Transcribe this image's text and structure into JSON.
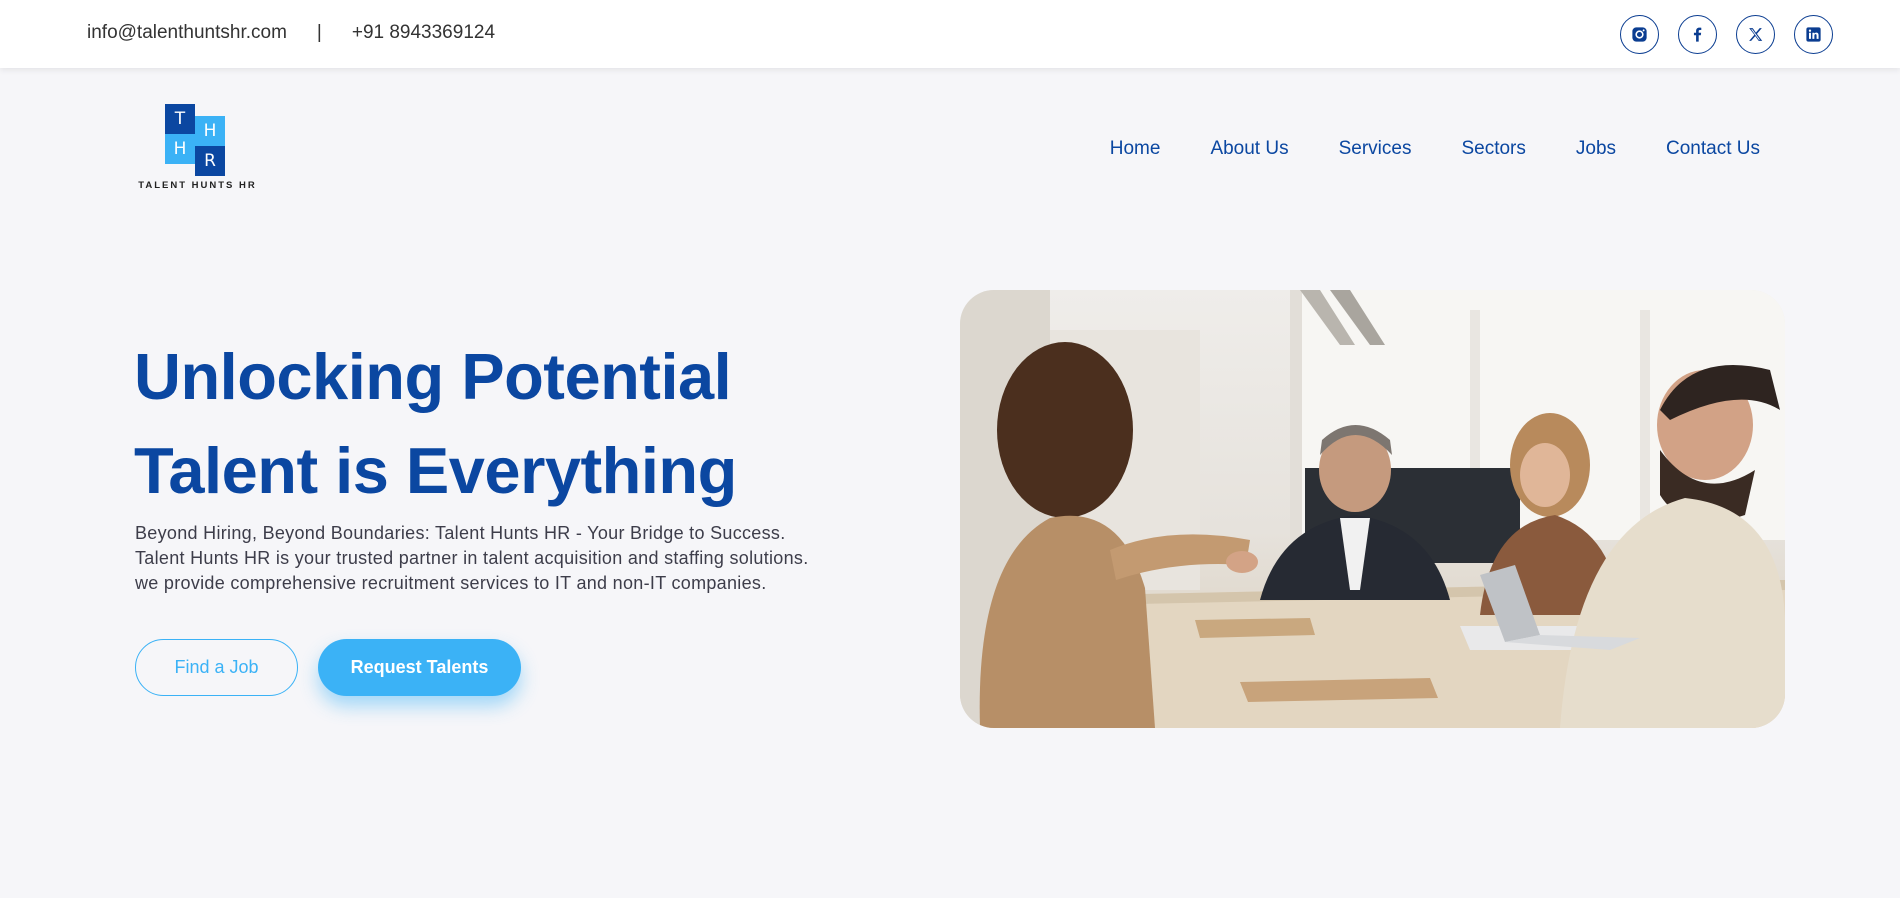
{
  "topbar": {
    "email": "info@talenthuntshr.com",
    "separator": "|",
    "phone": "+91 8943369124",
    "socials": [
      "instagram-icon",
      "facebook-icon",
      "x-icon",
      "linkedin-icon"
    ]
  },
  "logo": {
    "letters": [
      "T",
      "H",
      "H",
      "R"
    ],
    "text": "TALENT HUNTS HR"
  },
  "nav": {
    "items": [
      "Home",
      "About Us",
      "Services",
      "Sectors",
      "Jobs",
      "Contact Us"
    ]
  },
  "hero": {
    "title_line1": "Unlocking Potential",
    "title_line2": "Talent is Everything",
    "description": "Beyond Hiring, Beyond Boundaries: Talent Hunts HR - Your Bridge to Success. Talent Hunts HR is your trusted partner in talent acquisition and staffing solutions. we provide comprehensive recruitment services to IT and non-IT companies.",
    "btn_find_job": "Find a Job",
    "btn_request": "Request Talents"
  },
  "colors": {
    "primary": "#0b47a1",
    "accent": "#3bb2f6",
    "background": "#f6f6f9"
  }
}
